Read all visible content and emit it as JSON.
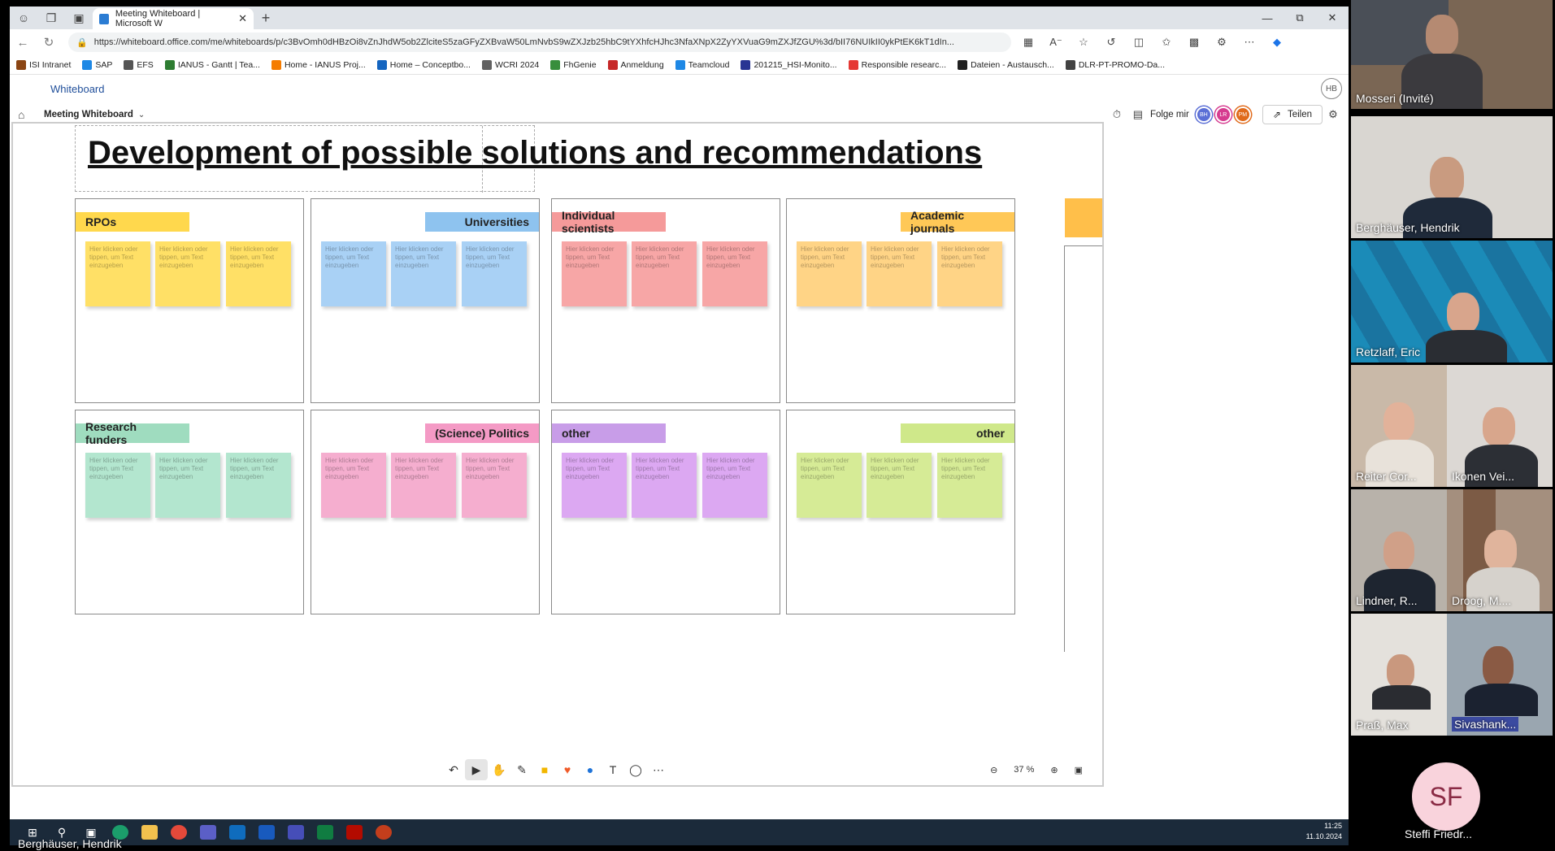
{
  "browser": {
    "tab_title": "Meeting Whiteboard | Microsoft W",
    "url": "https://whiteboard.office.com/me/whiteboards/p/c3BvOmh0dHBzOi8vZnJhdW5ob2ZlciteS5zaGFyZXBvaW50LmNvbS9wZXJzb25hbC9tYXhfcHJhc3NfaXNpX2ZyYXVuaG9mZXJfZGU%3d/bII76NUIkII0ykPtEK6kT1dIn...",
    "favorites": [
      {
        "label": "ISI Intranet",
        "color": "#8b4513"
      },
      {
        "label": "SAP",
        "color": "#1e88e5"
      },
      {
        "label": "EFS",
        "color": "#555555"
      },
      {
        "label": "IANUS - Gantt | Tea...",
        "color": "#2e7d32"
      },
      {
        "label": "Home - IANUS Proj...",
        "color": "#f57c00"
      },
      {
        "label": "Home – Conceptbo...",
        "color": "#1565c0"
      },
      {
        "label": "WCRI 2024",
        "color": "#616161"
      },
      {
        "label": "FhGenie",
        "color": "#388e3c"
      },
      {
        "label": "Anmeldung",
        "color": "#c62828"
      },
      {
        "label": "Teamcloud",
        "color": "#1e88e5"
      },
      {
        "label": "201215_HSI-Monito...",
        "color": "#283593"
      },
      {
        "label": "Responsible researc...",
        "color": "#e53935"
      },
      {
        "label": "Dateien - Austausch...",
        "color": "#212121"
      },
      {
        "label": "DLR-PT-PROMO-Da...",
        "color": "#424242"
      }
    ]
  },
  "app": {
    "name": "Whiteboard",
    "user_initials": "HB",
    "meeting_name": "Meeting Whiteboard",
    "follow_label": "Folge mir",
    "share_label": "Teilen",
    "presence": [
      {
        "initials": "BH",
        "color": "#5b6fd6"
      },
      {
        "initials": "LR",
        "color": "#d63b8f"
      },
      {
        "initials": "PM",
        "color": "#e06a1b"
      }
    ]
  },
  "board": {
    "title": "Development of possible solutions and recommendations",
    "note_placeholder": "Hier klicken oder tippen, um Text einzugeben",
    "panels": [
      {
        "label": "RPOs",
        "align": "left",
        "label_color": "#ffd84d",
        "note_color": "#ffe066"
      },
      {
        "label": "Universities",
        "align": "right",
        "label_color": "#8ec3ef",
        "note_color": "#a9d1f5"
      },
      {
        "label": "Individual scientists",
        "align": "left",
        "label_color": "#f59a9a",
        "note_color": "#f7a6a6"
      },
      {
        "label": "Academic journals",
        "align": "right",
        "label_color": "#ffc857",
        "note_color": "#ffd486"
      },
      {
        "label": "Research funders",
        "align": "left",
        "label_color": "#9fdcbf",
        "note_color": "#b3e6cf"
      },
      {
        "label": "(Science) Politics",
        "align": "right",
        "label_color": "#f49ac5",
        "note_color": "#f5aecf"
      },
      {
        "label": "other",
        "align": "left",
        "label_color": "#c89de8",
        "note_color": "#dca8f2"
      },
      {
        "label": "other",
        "align": "right",
        "label_color": "#cfe88a",
        "note_color": "#d6eb96"
      }
    ],
    "zoom": "37 %"
  },
  "taskbar": {
    "time": "11:25",
    "date": "11.10.2024",
    "presenter": "Berghäuser, Hendrik"
  },
  "participants": [
    {
      "name": "Mosseri (Invité)"
    },
    {
      "name": "Berghäuser, Hendrik"
    },
    {
      "name": "Retzlaff, Eric"
    },
    {
      "name": "Reiter Cor..."
    },
    {
      "name": "Ikonen Vei..."
    },
    {
      "name": "Lindner, R..."
    },
    {
      "name": "Droog, M...."
    },
    {
      "name": "Praß, Max"
    },
    {
      "name": "Sivashank..."
    },
    {
      "name": "Steffi Friedr...",
      "initials": "SF"
    }
  ]
}
